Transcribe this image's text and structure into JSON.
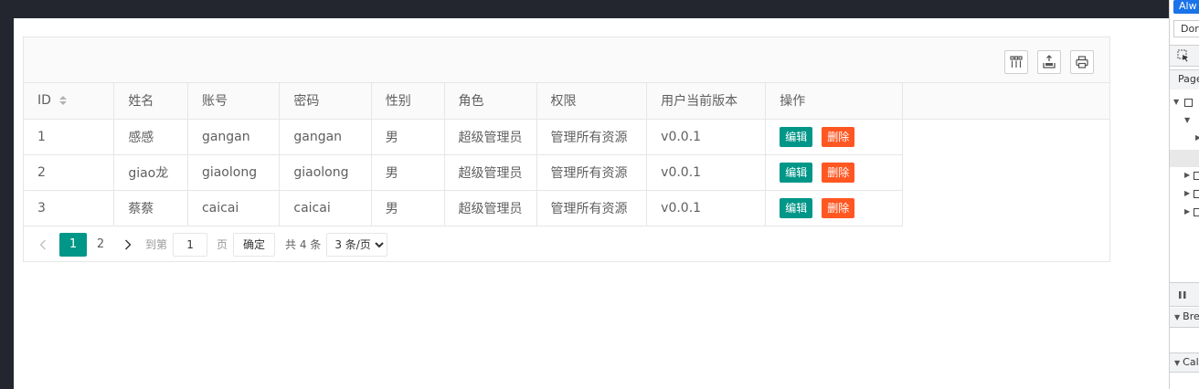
{
  "toolbar": {
    "icons": [
      "columns-icon",
      "export-icon",
      "print-icon"
    ]
  },
  "table": {
    "columns": [
      {
        "label": "ID",
        "sortable": true
      },
      {
        "label": "姓名"
      },
      {
        "label": "账号"
      },
      {
        "label": "密码"
      },
      {
        "label": "性别"
      },
      {
        "label": "角色"
      },
      {
        "label": "权限"
      },
      {
        "label": "用户当前版本"
      },
      {
        "label": "操作"
      }
    ],
    "rows": [
      {
        "id": "1",
        "name": "感感",
        "account": "gangan",
        "password": "gangan",
        "gender": "男",
        "role": "超级管理员",
        "permission": "管理所有资源",
        "version": "v0.0.1"
      },
      {
        "id": "2",
        "name": "giao龙",
        "account": "giaolong",
        "password": "giaolong",
        "gender": "男",
        "role": "超级管理员",
        "permission": "管理所有资源",
        "version": "v0.0.1"
      },
      {
        "id": "3",
        "name": "蔡蔡",
        "account": "caicai",
        "password": "caicai",
        "gender": "男",
        "role": "超级管理员",
        "permission": "管理所有资源",
        "version": "v0.0.1"
      }
    ],
    "edit_label": "编辑",
    "delete_label": "删除"
  },
  "pager": {
    "pages": [
      "1",
      "2"
    ],
    "current": "1",
    "goto_prefix": "到第",
    "goto_value": "1",
    "goto_suffix": "页",
    "confirm_label": "确定",
    "total_text": "共 4 条",
    "page_size": "3 条/页"
  },
  "colors": {
    "accent": "#009688",
    "danger": "#ff5722",
    "header_bg": "#23262e",
    "devtools_blue": "#1a73e8"
  },
  "devtools": {
    "button": "Alw",
    "input": "Dor",
    "tab": "Page",
    "section1": "Bre",
    "section2": "Cal"
  }
}
